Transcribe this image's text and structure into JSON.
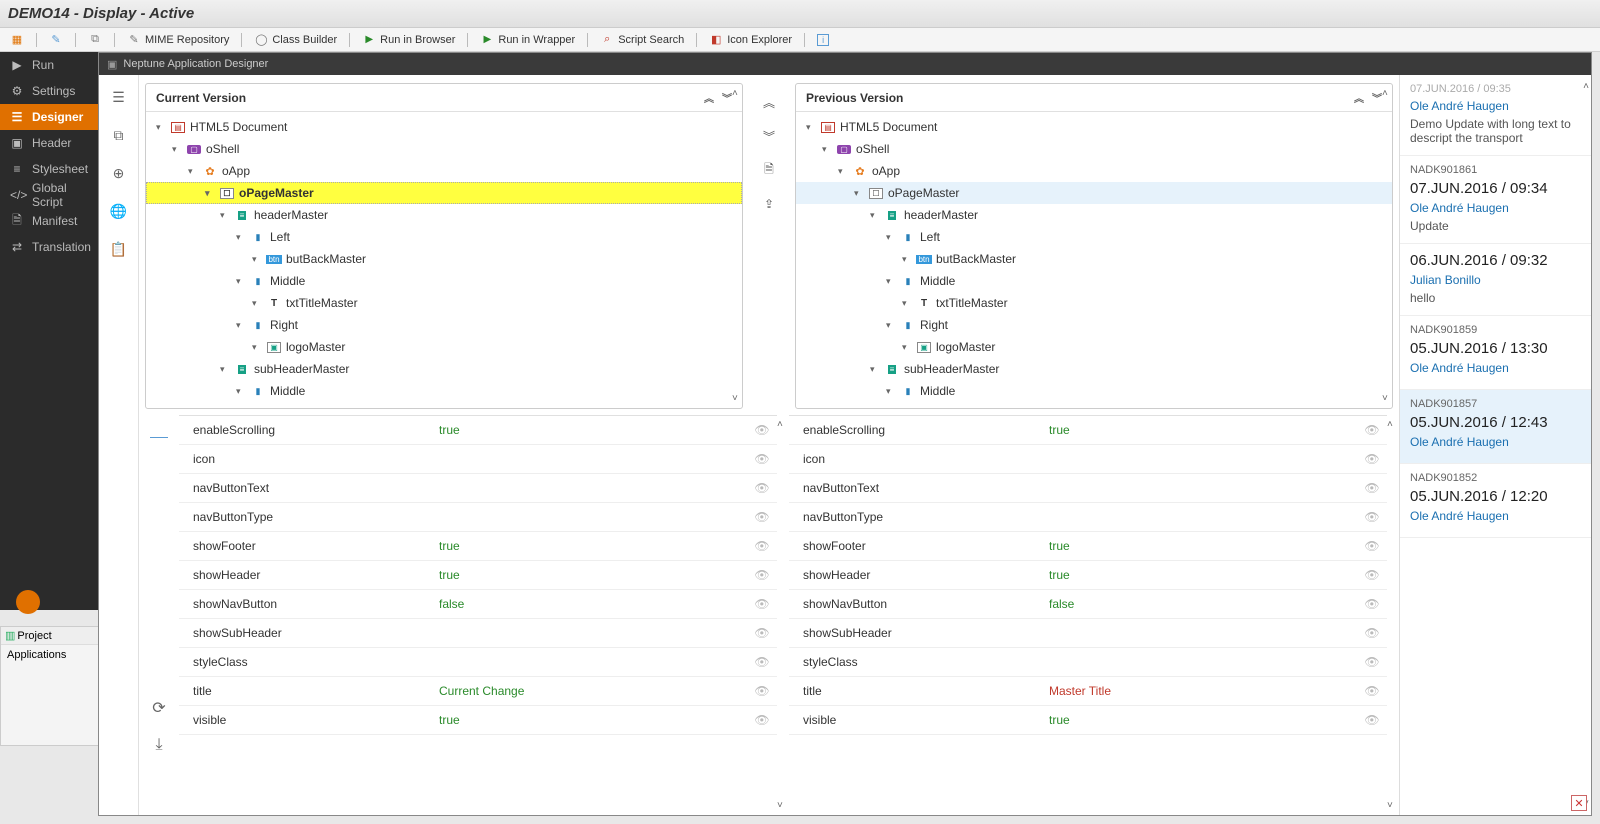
{
  "window_title": "DEMO14 - Display - Active",
  "toolbar": {
    "mime_repository": "MIME Repository",
    "class_builder": "Class Builder",
    "run_browser": "Run in Browser",
    "run_wrapper": "Run in Wrapper",
    "script_search": "Script Search",
    "icon_explorer": "Icon Explorer"
  },
  "leftnav": {
    "run": "Run",
    "settings": "Settings",
    "designer": "Designer",
    "header": "Header",
    "stylesheet": "Stylesheet",
    "globalscript": "Global Script",
    "manifest": "Manifest",
    "translation": "Translation"
  },
  "bl_panel": {
    "project": "Project",
    "applications": "Applications"
  },
  "modal": {
    "title": "Neptune Application Designer"
  },
  "tree": {
    "current_title": "Current Version",
    "previous_title": "Previous Version",
    "nodes": [
      {
        "indent": 0,
        "label": "HTML5 Document",
        "icon": "doc"
      },
      {
        "indent": 1,
        "label": "oShell",
        "icon": "shell"
      },
      {
        "indent": 2,
        "label": "oApp",
        "icon": "app"
      },
      {
        "indent": 3,
        "label": "oPageMaster",
        "icon": "page",
        "sel": true
      },
      {
        "indent": 4,
        "label": "headerMaster",
        "icon": "bar"
      },
      {
        "indent": 5,
        "label": "Left",
        "icon": "slot"
      },
      {
        "indent": 6,
        "label": "butBackMaster",
        "icon": "btn"
      },
      {
        "indent": 5,
        "label": "Middle",
        "icon": "slot"
      },
      {
        "indent": 6,
        "label": "txtTitleMaster",
        "icon": "txt"
      },
      {
        "indent": 5,
        "label": "Right",
        "icon": "slot"
      },
      {
        "indent": 6,
        "label": "logoMaster",
        "icon": "img"
      },
      {
        "indent": 4,
        "label": "subHeaderMaster",
        "icon": "bar"
      },
      {
        "indent": 5,
        "label": "Middle",
        "icon": "slot"
      }
    ]
  },
  "props": [
    {
      "name": "enableScrolling",
      "cur": "true",
      "prev": "true"
    },
    {
      "name": "icon",
      "cur": "",
      "prev": ""
    },
    {
      "name": "navButtonText",
      "cur": "",
      "prev": ""
    },
    {
      "name": "navButtonType",
      "cur": "",
      "prev": ""
    },
    {
      "name": "showFooter",
      "cur": "true",
      "prev": "true"
    },
    {
      "name": "showHeader",
      "cur": "true",
      "prev": "true"
    },
    {
      "name": "showNavButton",
      "cur": "false",
      "prev": "false"
    },
    {
      "name": "showSubHeader",
      "cur": "",
      "prev": ""
    },
    {
      "name": "styleClass",
      "cur": "",
      "prev": ""
    },
    {
      "name": "title",
      "cur": "Current Change",
      "prev": "Master Title",
      "changed": true
    },
    {
      "name": "visible",
      "cur": "true",
      "prev": "true"
    }
  ],
  "history": [
    {
      "id": "",
      "date": "",
      "user": "Ole André Haugen",
      "msg": "Demo Update with long text to descript the transport",
      "partial_date": "07.JUN.2016 / 09:35"
    },
    {
      "id": "NADK901861",
      "date": "07.JUN.2016 / 09:34",
      "user": "Ole André Haugen",
      "msg": "Update"
    },
    {
      "id": "",
      "date": "06.JUN.2016 / 09:32",
      "user": "Julian Bonillo",
      "msg": "hello"
    },
    {
      "id": "NADK901859",
      "date": "05.JUN.2016 / 13:30",
      "user": "Ole André Haugen",
      "msg": ""
    },
    {
      "id": "NADK901857",
      "date": "05.JUN.2016 / 12:43",
      "user": "Ole André Haugen",
      "msg": "",
      "sel": true
    },
    {
      "id": "NADK901852",
      "date": "05.JUN.2016 / 12:20",
      "user": "Ole André Haugen",
      "msg": ""
    }
  ]
}
